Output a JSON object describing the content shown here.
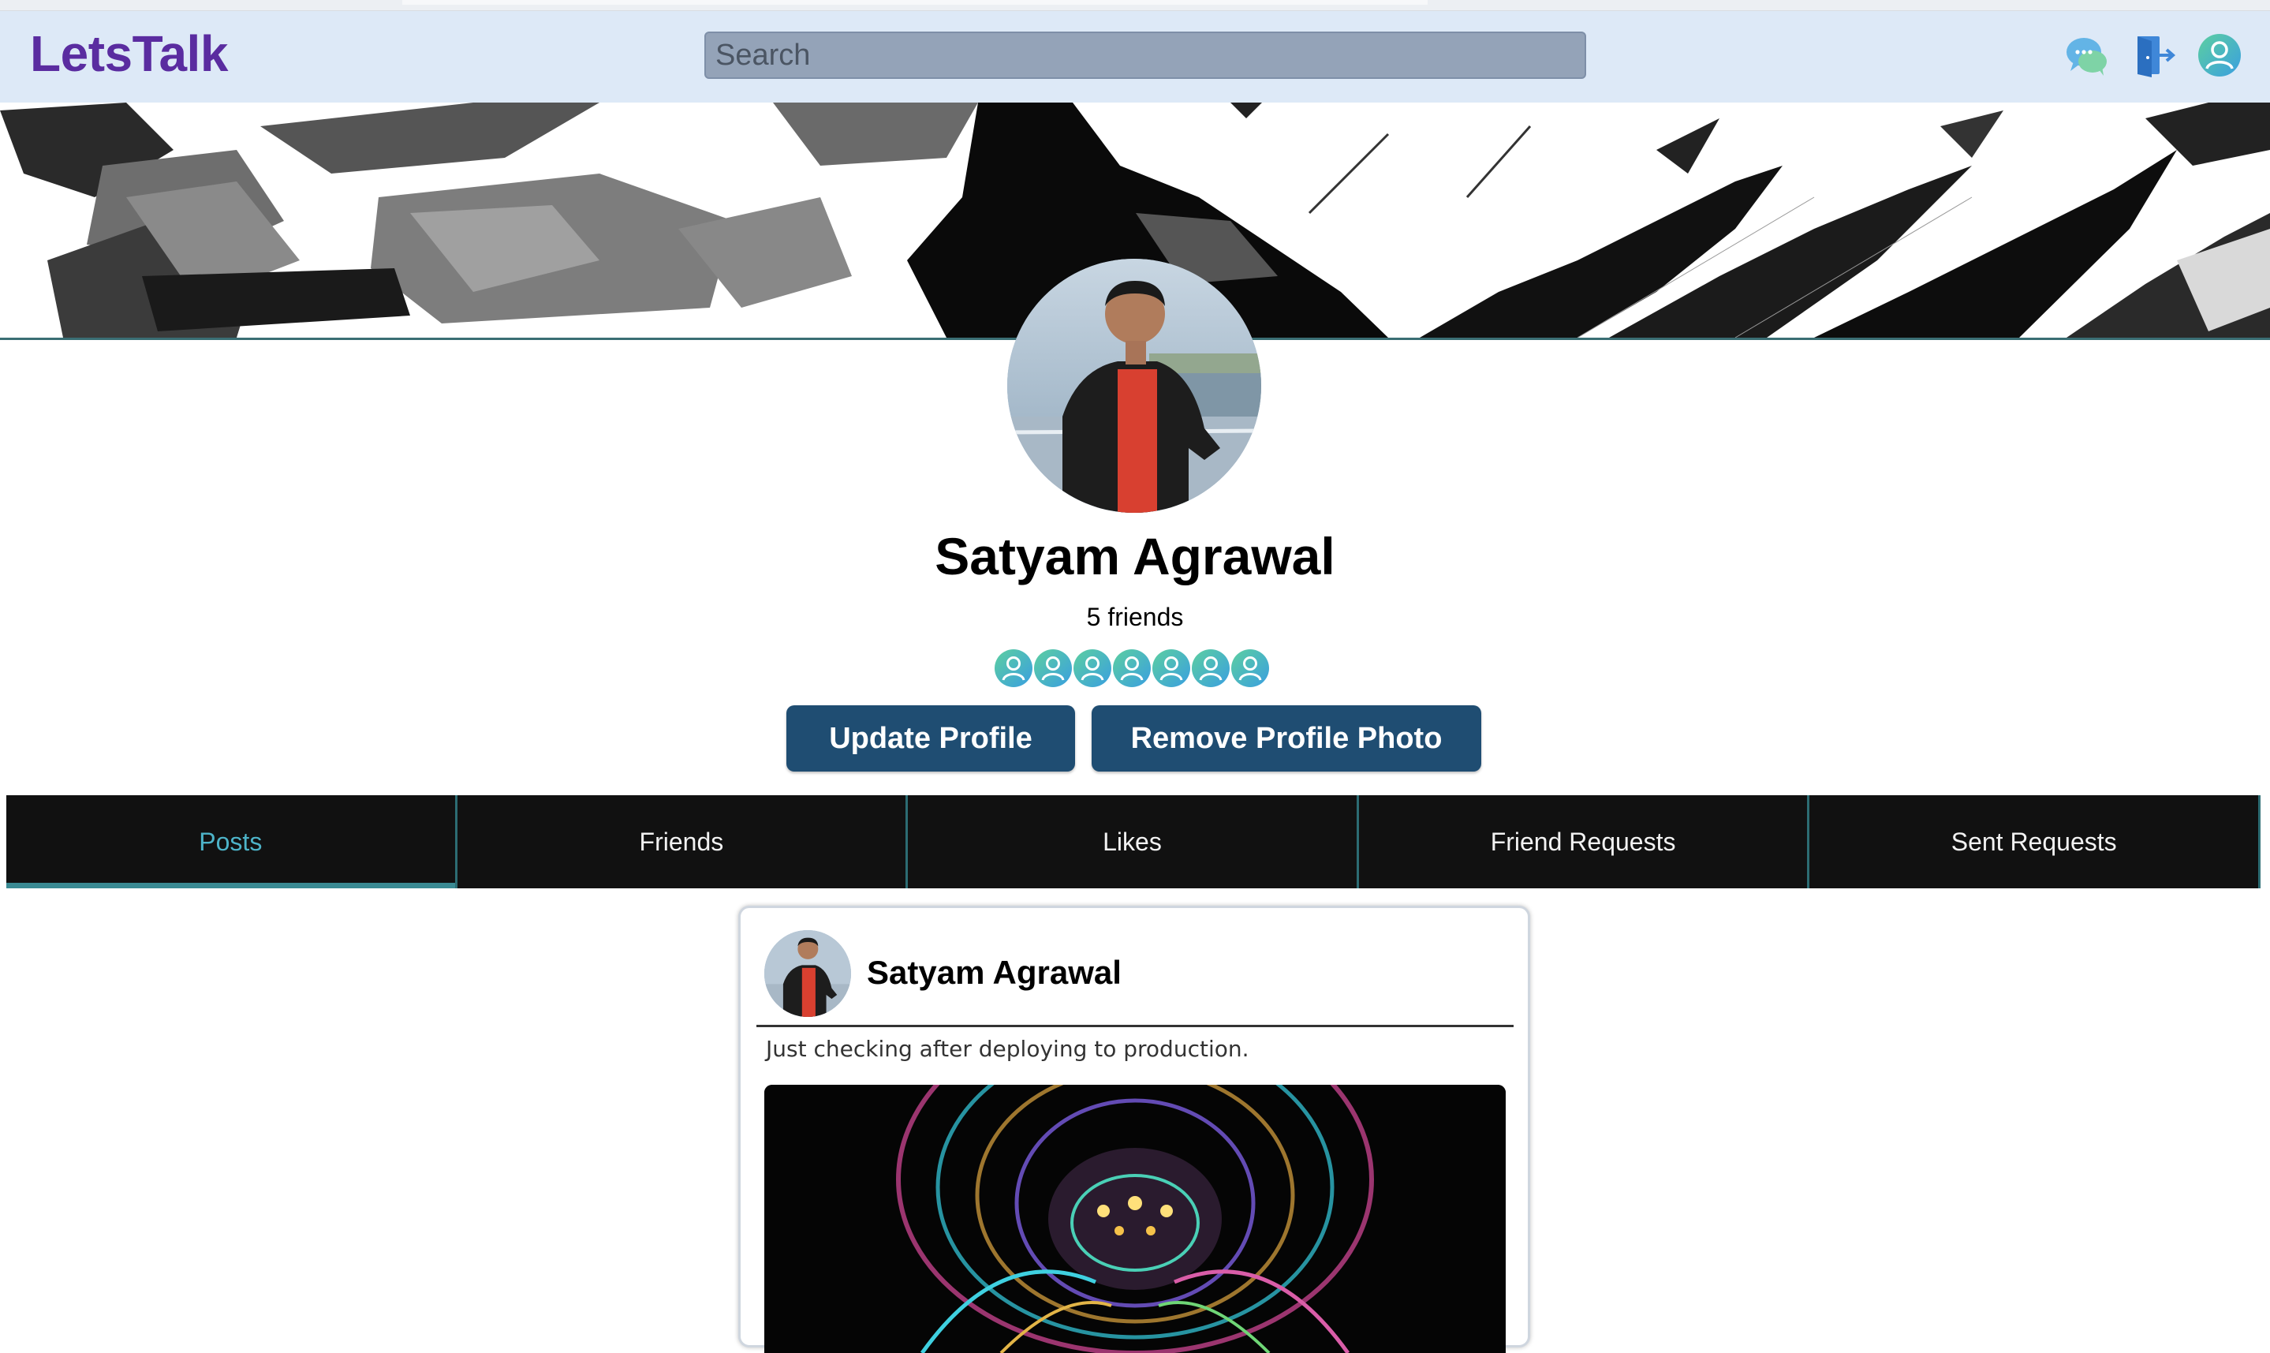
{
  "app": {
    "logo": "LetsTalk"
  },
  "search": {
    "placeholder": "Search"
  },
  "profile": {
    "name": "Satyam Agrawal",
    "friends_count_label": "5 friends"
  },
  "actions": {
    "update_label": "Update Profile",
    "remove_photo_label": "Remove Profile Photo"
  },
  "tabs": [
    {
      "label": "Posts",
      "active": true
    },
    {
      "label": "Friends",
      "active": false
    },
    {
      "label": "Likes",
      "active": false
    },
    {
      "label": "Friend Requests",
      "active": false
    },
    {
      "label": "Sent Requests",
      "active": false
    }
  ],
  "post": {
    "author": "Satyam Agrawal",
    "text": "Just checking after deploying to production."
  },
  "icons": {
    "chat": "chat-bubbles-icon",
    "logout": "logout-door-icon",
    "profile": "user-avatar-icon"
  },
  "colors": {
    "accent": "#5a2ca0",
    "button": "#1f4d72",
    "tab_active": "#4db3c8",
    "navbar_bg": "#dde9f7"
  }
}
